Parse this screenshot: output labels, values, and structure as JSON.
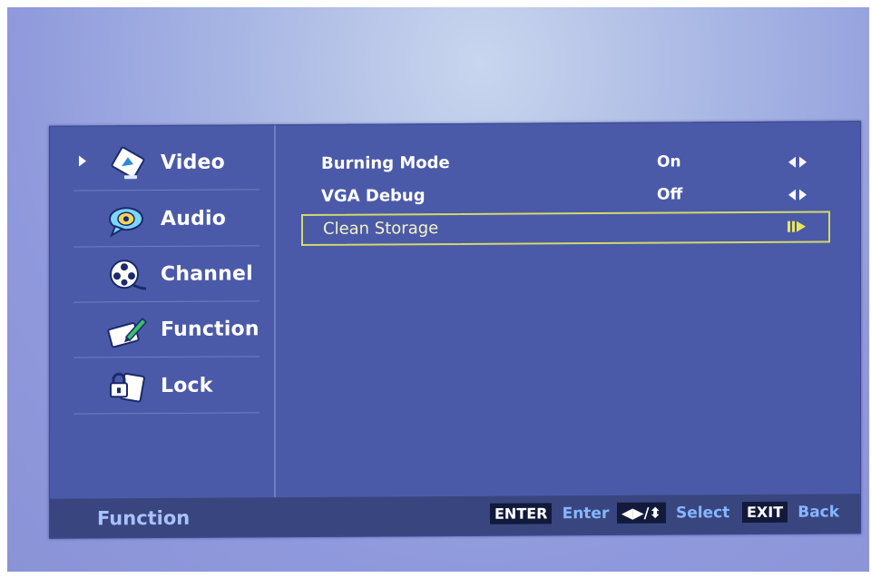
{
  "sidebar": {
    "items": [
      {
        "label": "Video",
        "icon": "video-icon",
        "active": true
      },
      {
        "label": "Audio",
        "icon": "audio-icon"
      },
      {
        "label": "Channel",
        "icon": "channel-icon"
      },
      {
        "label": "Function",
        "icon": "function-icon"
      },
      {
        "label": "Lock",
        "icon": "lock-icon"
      }
    ]
  },
  "settings": {
    "rows": [
      {
        "label": "Burning Mode",
        "value": "On",
        "control": "left-right-arrows"
      },
      {
        "label": "VGA Debug",
        "value": "Off",
        "control": "left-right-arrows"
      },
      {
        "label": "Clean Storage",
        "value": "",
        "control": "enter-arrow",
        "selected": true
      }
    ]
  },
  "footer": {
    "title": "Function",
    "hints": [
      {
        "key": "ENTER",
        "label": "Enter"
      },
      {
        "key": "◀▶/⬍",
        "label": "Select"
      },
      {
        "key": "EXIT",
        "label": "Back"
      }
    ]
  },
  "colors": {
    "panel": "#4b5aa8",
    "footer": "#39457e",
    "selection_border": "#d4d86a",
    "hint_text": "#86b6ff",
    "footer_title": "#a9c1ff"
  }
}
